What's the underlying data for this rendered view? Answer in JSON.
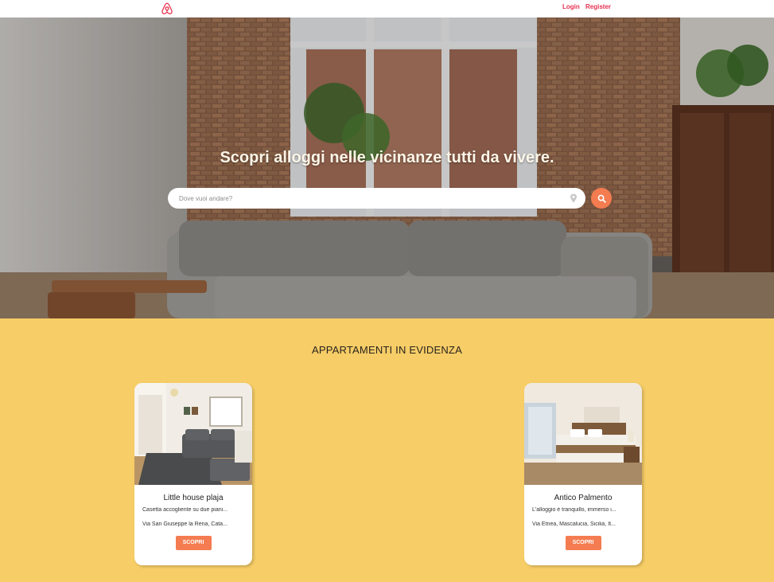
{
  "header": {
    "login_label": "Login",
    "register_label": "Register",
    "brand_color": "#e8304f"
  },
  "hero": {
    "title": "Scopri alloggi nelle vicinanze tutti da vivere.",
    "search_placeholder": "Dove vuoi andare?",
    "search_icon": "search-icon",
    "location_icon": "map-pin-icon",
    "accent_color": "#f47c50"
  },
  "featured": {
    "title": "APPARTAMENTI IN EVIDENZA",
    "background_color": "#f6cd66",
    "cards": [
      {
        "title": "Little house plaja",
        "description": "Casetta accogliente su due piani...",
        "address": "Via San Giuseppe la Rena, Cata...",
        "button_label": "SCOPRI"
      },
      {
        "title": "Antico Palmento",
        "description": "L'alloggio è tranquillo, immerso i...",
        "address": "Via Etnea, Mascalucia, Sicilia, It...",
        "button_label": "SCOPRI"
      }
    ]
  }
}
